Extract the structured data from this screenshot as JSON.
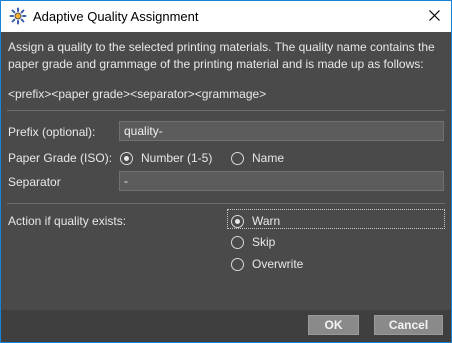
{
  "window": {
    "title": "Adaptive Quality Assignment",
    "icon": "gear-sparkle-icon",
    "close_icon": "close-icon"
  },
  "description": "Assign a quality to the selected printing materials. The quality name contains the paper grade and grammage of the printing material and is made up as follows:",
  "format_pattern": "<prefix><paper grade><separator><grammage>",
  "prefix": {
    "label": "Prefix (optional):",
    "value": "quality-"
  },
  "paper_grade": {
    "label": "Paper Grade (ISO):",
    "options": [
      "Number (1-5)",
      "Name"
    ],
    "selected": "Number (1-5)"
  },
  "separator_field": {
    "label": "Separator",
    "value": "-"
  },
  "action": {
    "label": "Action if quality exists:",
    "options": [
      "Warn",
      "Skip",
      "Overwrite"
    ],
    "selected": "Warn"
  },
  "buttons": {
    "ok": "OK",
    "cancel": "Cancel"
  },
  "colors": {
    "background": "#4a4a4a",
    "titlebar": "#ffffff",
    "border_accent": "#1883d7",
    "button": "#8a8a8a"
  }
}
